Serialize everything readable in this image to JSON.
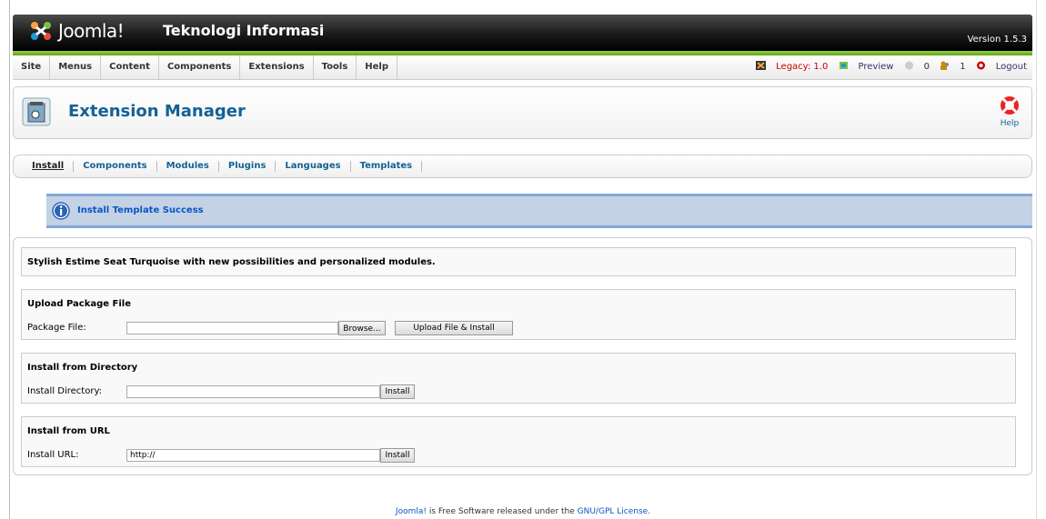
{
  "header": {
    "brand": "Joomla!",
    "site_name": "Teknologi Informasi",
    "version": "Version 1.5.3"
  },
  "menu": {
    "items": [
      "Site",
      "Menus",
      "Content",
      "Components",
      "Extensions",
      "Tools",
      "Help"
    ]
  },
  "status": {
    "legacy": "Legacy: 1.0",
    "preview": "Preview",
    "messages_count": "0",
    "users_count": "1",
    "logout": "Logout"
  },
  "toolbar": {
    "title": "Extension Manager",
    "help_label": "Help"
  },
  "submenu": {
    "items": [
      "Install",
      "Components",
      "Modules",
      "Plugins",
      "Languages",
      "Templates"
    ]
  },
  "message": {
    "text": "Install Template Success"
  },
  "description": "Stylish Estime Seat Turquoise with new possibilities and personalized modules.",
  "upload": {
    "legend": "Upload Package File",
    "label": "Package File:",
    "browse_label": "Browse...",
    "submit_label": "Upload File & Install"
  },
  "directory": {
    "legend": "Install from Directory",
    "label": "Install Directory:",
    "value": "",
    "button_label": "Install"
  },
  "url": {
    "legend": "Install from URL",
    "label": "Install URL:",
    "value": "http://",
    "button_label": "Install"
  },
  "footer": {
    "brand_link": "Joomla!",
    "middle_text": " is Free Software released under the ",
    "license_link": "GNU/GPL License",
    "end": "."
  },
  "colors": {
    "header_dark": "#000000",
    "accent_green": "#5aa512",
    "title_blue": "#146295",
    "message_bg": "#c3d2e5",
    "message_border": "#84a7db",
    "link_blue": "#0b55c4"
  }
}
